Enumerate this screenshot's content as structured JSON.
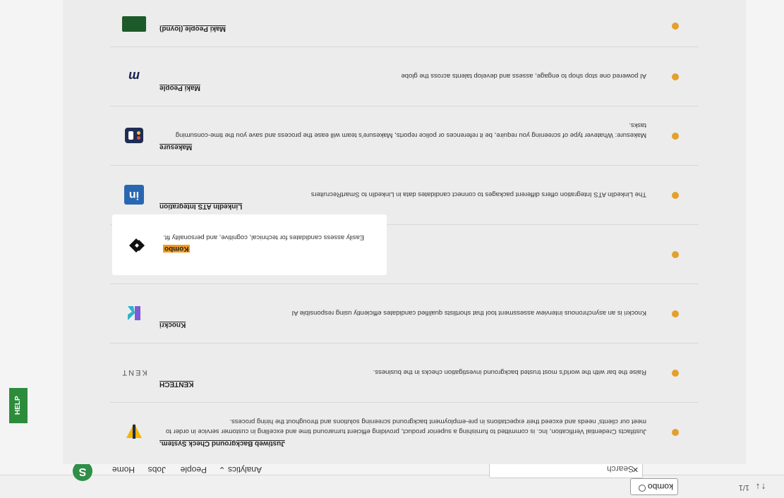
{
  "find_bar": {
    "query": "kombo",
    "match_count": "1/1",
    "prev_symbol": "↑",
    "next_symbol": "↓"
  },
  "nav": {
    "logo_letter": "S",
    "items": [
      {
        "label": "Home"
      },
      {
        "label": "Jobs"
      },
      {
        "label": "People"
      },
      {
        "label": "Analytics ⌄"
      }
    ],
    "search_placeholder": "Search",
    "search_clear": "✕"
  },
  "help_tab": {
    "label": "HELP"
  },
  "rows": [
    {
      "title": "Justiweb Background Check System.",
      "desc": "Justifacts Credential Verification, Inc. is committed to furnishing a superior product, providing efficient turnaround time and excelling in customer service in order to meet our clients' needs and exceed their expectations in pre-employment background screening solutions and throughout the hiring process.",
      "logo_label": "Justifacts"
    },
    {
      "title": "KENTECH",
      "desc": "Raise the bar with the world's most trusted background investigation checks in the business.",
      "logo_label": "KENT"
    },
    {
      "title": "Knockri",
      "desc": "Knockri is an asynchronous interview assessment tool that shortlists qualified candidates efficiently using responsible AI",
      "logo_label": "knockri"
    },
    {
      "title": "Kombo",
      "desc": "Easily assess candidates for technical, cognitive, and personality fit.",
      "logo_label": ""
    },
    {
      "title": "LinkedIn ATS Integration",
      "desc": "The LinkedIn ATS Integration offers different packages to connect candidates data in LinkedIn to SmartRecruiters",
      "logo_label": "in"
    },
    {
      "title": "Makesure",
      "desc": "Makesure: Whatever type of screening you require, be it references or police reports, Makesure's team will ease the process and save you the time-consuming tasks.",
      "logo_label": ""
    },
    {
      "title": "Maki People",
      "desc": "AI powered one stop shop to engage, assess and develop talents across the globe",
      "logo_label": "m"
    },
    {
      "title": "Maki People (Ioynd)",
      "desc": "",
      "logo_label": ""
    }
  ],
  "colors": {
    "status_dot": "#e3a02c",
    "highlight": "#f39a1f",
    "brand_green": "#2f8f46"
  }
}
